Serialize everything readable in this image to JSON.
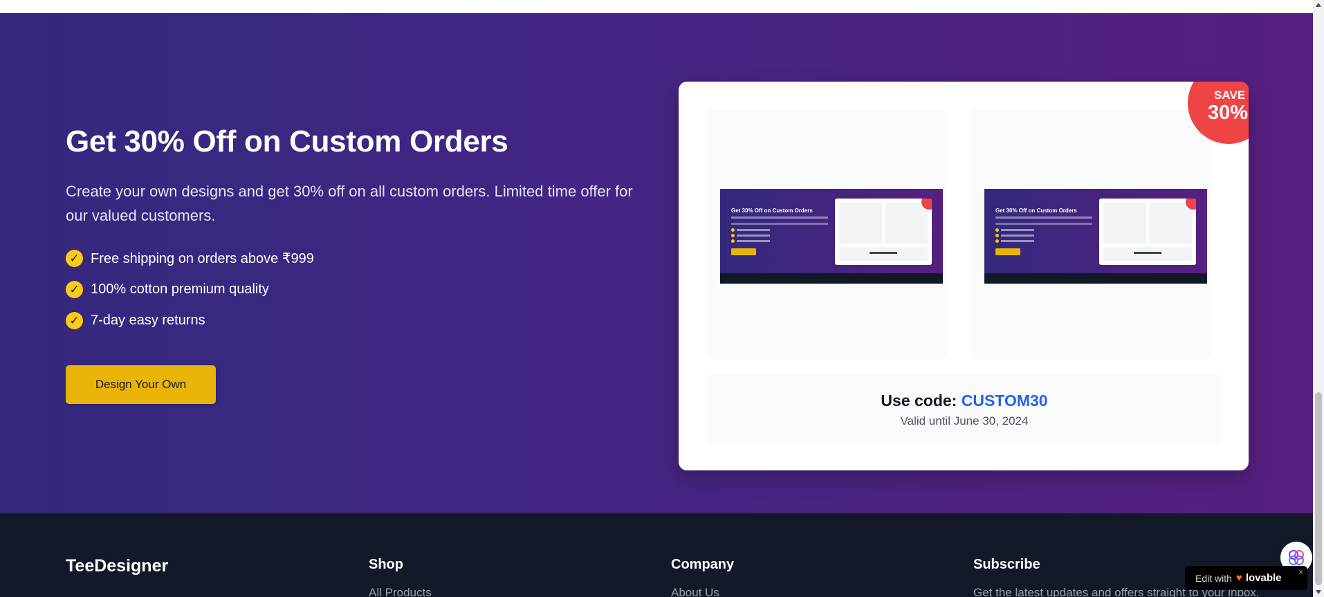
{
  "promo": {
    "title": "Get 30% Off on Custom Orders",
    "description": "Create your own designs and get 30% off on all custom orders. Limited time offer for our valued customers.",
    "features": [
      "Free shipping on orders above ₹999",
      "100% cotton premium quality",
      "7-day easy returns"
    ],
    "check_glyph": "✓",
    "cta_label": "Design Your Own"
  },
  "offer_card": {
    "badge_top": "SAVE",
    "badge_value": "30%",
    "preview_title": "Get 30% Off on Custom Orders",
    "code_label": "Use code:",
    "code_value": "CUSTOM30",
    "valid_text": "Valid until June 30, 2024"
  },
  "footer": {
    "brand": "TeeDesigner",
    "columns": [
      {
        "heading": "Shop",
        "first_link": "All Products"
      },
      {
        "heading": "Company",
        "first_link": "About Us"
      },
      {
        "heading": "Subscribe",
        "first_link": "Get the latest updates and offers straight to your inbox."
      }
    ]
  },
  "lovable_badge": {
    "edit_label": "Edit with",
    "brand": "lovable",
    "close": "×"
  },
  "colors": {
    "gradient_start": "#33297d",
    "gradient_end": "#56207f",
    "accent_yellow": "#eab308",
    "code_blue": "#2563eb",
    "badge_red": "#ef4444",
    "footer_bg": "#131928"
  },
  "icons": [
    "check-icon",
    "heart-icon",
    "brain-icon",
    "close-icon"
  ]
}
